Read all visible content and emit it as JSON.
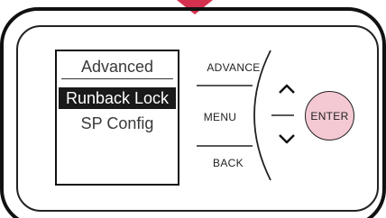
{
  "screen": {
    "title": "Advanced",
    "items": [
      {
        "label": "Runback Lock",
        "selected": true
      },
      {
        "label": "SP Config",
        "selected": false
      }
    ]
  },
  "buttons": {
    "advance": "ADVANCE",
    "menu": "MENU",
    "back": "BACK",
    "enter": "ENTER"
  },
  "icons": {
    "up": "chevron-up-icon",
    "down": "chevron-down-icon",
    "indicator": "down-arrow-indicator-icon"
  },
  "colors": {
    "indicator": "#d6304f",
    "enter_button": "#f4c9d3",
    "outline": "#111111"
  }
}
